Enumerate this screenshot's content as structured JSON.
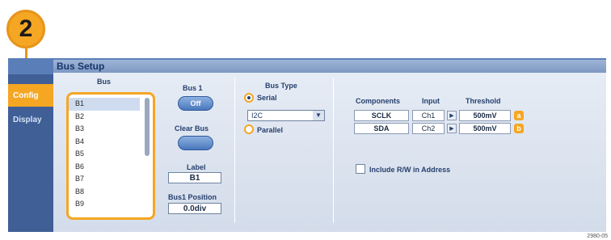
{
  "step_number": "2",
  "window": {
    "title": "Bus Setup"
  },
  "tabs": [
    {
      "label": "Config",
      "active": true
    },
    {
      "label": "Display",
      "active": false
    }
  ],
  "bus": {
    "header": "Bus",
    "items": [
      "B1",
      "B2",
      "B3",
      "B4",
      "B5",
      "B6",
      "B7",
      "B8",
      "B9"
    ],
    "selected": "B1"
  },
  "bus1": {
    "header": "Bus 1",
    "toggle_label": "Off",
    "clear_label": "Clear Bus",
    "label_header": "Label",
    "label_value": "B1",
    "position_header": "Bus1 Position",
    "position_value": "0.0div"
  },
  "bus_type": {
    "header": "Bus Type",
    "serial_label": "Serial",
    "protocol_value": "I2C",
    "parallel_label": "Parallel",
    "selected": "Serial"
  },
  "components": {
    "headers": {
      "components": "Components",
      "input": "Input",
      "threshold": "Threshold"
    },
    "rows": [
      {
        "name": "SCLK",
        "input": "Ch1",
        "threshold": "500mV",
        "marker": "a"
      },
      {
        "name": "SDA",
        "input": "Ch2",
        "threshold": "500mV",
        "marker": "b"
      }
    ]
  },
  "include_rw": {
    "label": "Include R/W in Address",
    "checked": false
  },
  "figure_id": "2980-05",
  "colors": {
    "accent": "#f5a623",
    "panel": "#5a7fb8",
    "content_bg": "#dfe6f1"
  }
}
